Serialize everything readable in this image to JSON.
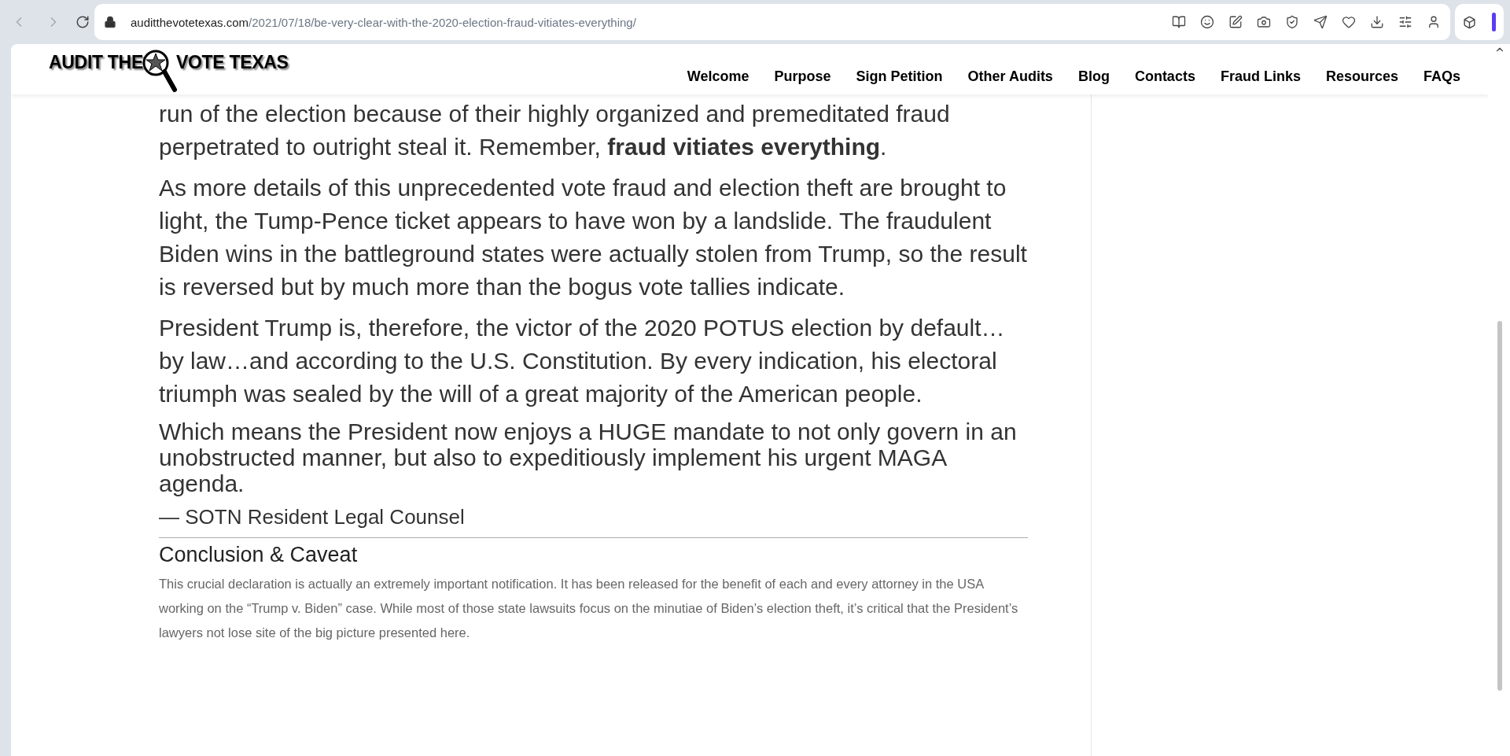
{
  "browser": {
    "url_domain": "auditthevotetexas.com",
    "url_path": "/2021/07/18/be-very-clear-with-the-2020-election-fraud-vitiates-everything/"
  },
  "site": {
    "logo_left": "AUDIT THE",
    "logo_right": "VOTE TEXAS",
    "nav": [
      "Welcome",
      "Purpose",
      "Sign Petition",
      "Other Audits",
      "Blog",
      "Contacts",
      "Fraud Links",
      "Resources",
      "FAQs"
    ]
  },
  "article": {
    "paragraphs": [
      {
        "kind": "normal",
        "text": "run of the election because of their highly organized and premeditated fraud perpetrated to outright steal it.  Remember, **fraud vitiates everything**."
      },
      {
        "kind": "normal",
        "text": "As more details of this unprecedented vote fraud and election theft are brought to light, the Tump-Pence ticket appears to have won by a landslide. The fraudulent Biden wins in the battleground states were actually stolen from Trump, so the result is reversed but by much more than the bogus vote tallies indicate."
      },
      {
        "kind": "normal",
        "text": "President Trump is, therefore, the victor of the 2020 POTUS election by default…by law…and according to the U.S. Constitution. By every indication, his electoral triumph was sealed by the will of a great majority of the American people."
      },
      {
        "kind": "tight",
        "text": "Which means the President now enjoys a HUGE mandate to not only govern in an unobstructed manner, but also to expeditiously implement his urgent MAGA agenda."
      },
      {
        "kind": "signature",
        "text": "— SOTN Resident Legal Counsel"
      }
    ],
    "section_heading": "Conclusion & Caveat",
    "section_text": "This crucial declaration is actually an extremely important notification. It has been released for the benefit of each and every attorney in the USA working on the “Trump v. Biden” case. While most of those state lawsuits focus on the minutiae of Biden’s election theft, it’s critical that the President’s lawyers not lose site of the big picture presented here."
  }
}
